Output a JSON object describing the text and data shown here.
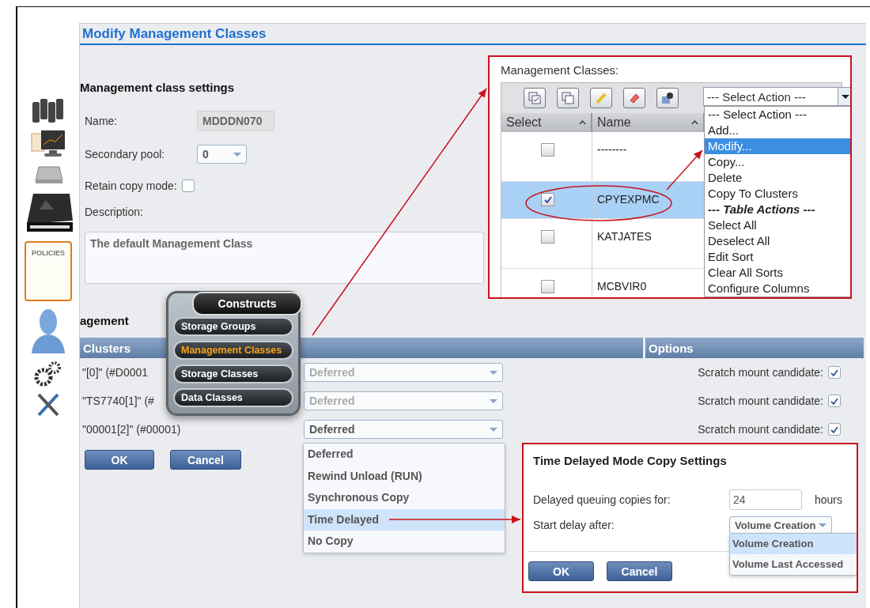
{
  "page": {
    "title": "Modify Management Classes"
  },
  "sidebar": {
    "notepad_label": "POLICIES"
  },
  "settings": {
    "heading": "Management class settings",
    "name_label": "Name:",
    "name_value": "MDDDN070",
    "pool_label": "Secondary pool:",
    "pool_value": "0",
    "retain_label": "Retain copy mode:",
    "retain_checked": false,
    "description_label": "Description:",
    "description_value": "The default Management Class"
  },
  "clusters": {
    "heading": "agement",
    "columns": [
      "Clusters",
      "Options"
    ],
    "rows": [
      {
        "name": "\"[0]\" (#D0001",
        "copy_mode": "Deferred",
        "option_label": "Scratch mount candidate:",
        "checked": true
      },
      {
        "name": "\"TS7740[1]\" (#",
        "copy_mode": "Deferred",
        "option_label": "Scratch mount candidate:",
        "checked": true
      },
      {
        "name": "\"00001[2]\" (#00001)",
        "copy_mode": "Deferred",
        "option_label": "Scratch mount candidate:",
        "checked": true
      }
    ],
    "buttons": [
      "OK",
      "Cancel"
    ]
  },
  "copy_mode_menu": {
    "items": [
      {
        "label": "Deferred",
        "selected": false
      },
      {
        "label": "Rewind Unload (RUN)",
        "selected": false
      },
      {
        "label": "Synchronous Copy",
        "selected": false
      },
      {
        "label": "Time Delayed",
        "selected": true
      },
      {
        "label": "No Copy",
        "selected": false
      }
    ]
  },
  "constructs_menu": {
    "title": "Constructs",
    "items": [
      {
        "label": "Storage Groups",
        "selected": false
      },
      {
        "label": "Management Classes",
        "selected": true
      },
      {
        "label": "Storage Classes",
        "selected": false
      },
      {
        "label": "Data Classes",
        "selected": false
      }
    ]
  },
  "classes_panel": {
    "label": "Management Classes:",
    "action_select": "--- Select Action ---",
    "columns": [
      "Select",
      "Name"
    ],
    "rows": [
      {
        "name": "--------",
        "checked": false,
        "selected": false
      },
      {
        "name": "CPYEXPMC",
        "checked": true,
        "selected": true
      },
      {
        "name": "KATJATES",
        "checked": false,
        "selected": false
      },
      {
        "name": "MCBVIR0",
        "checked": false,
        "selected": false
      }
    ],
    "action_menu": [
      {
        "label": "--- Select Action ---",
        "kind": "option",
        "selected": false
      },
      {
        "label": "Add...",
        "kind": "option",
        "selected": false
      },
      {
        "label": "Modify...",
        "kind": "option",
        "selected": true
      },
      {
        "label": "Copy...",
        "kind": "option",
        "selected": false
      },
      {
        "label": "Delete",
        "kind": "option",
        "selected": false
      },
      {
        "label": "Copy To Clusters",
        "kind": "option",
        "selected": false
      },
      {
        "label": "--- Table Actions ---",
        "kind": "header",
        "selected": false
      },
      {
        "label": "Select All",
        "kind": "option",
        "selected": false
      },
      {
        "label": "Deselect All",
        "kind": "option",
        "selected": false
      },
      {
        "label": "Edit Sort",
        "kind": "option",
        "selected": false
      },
      {
        "label": "Clear All Sorts",
        "kind": "option",
        "selected": false
      },
      {
        "label": "Configure Columns",
        "kind": "option",
        "selected": false
      }
    ]
  },
  "delay_panel": {
    "title": "Time Delayed Mode Copy Settings",
    "queue_label": "Delayed queuing copies for:",
    "queue_value": "24",
    "queue_unit": "hours",
    "start_label": "Start delay after:",
    "start_value": "Volume Creation",
    "start_options": [
      {
        "label": "Volume Creation",
        "selected": true
      },
      {
        "label": "Volume Last Accessed",
        "selected": false
      }
    ],
    "buttons": [
      "OK",
      "Cancel"
    ]
  }
}
